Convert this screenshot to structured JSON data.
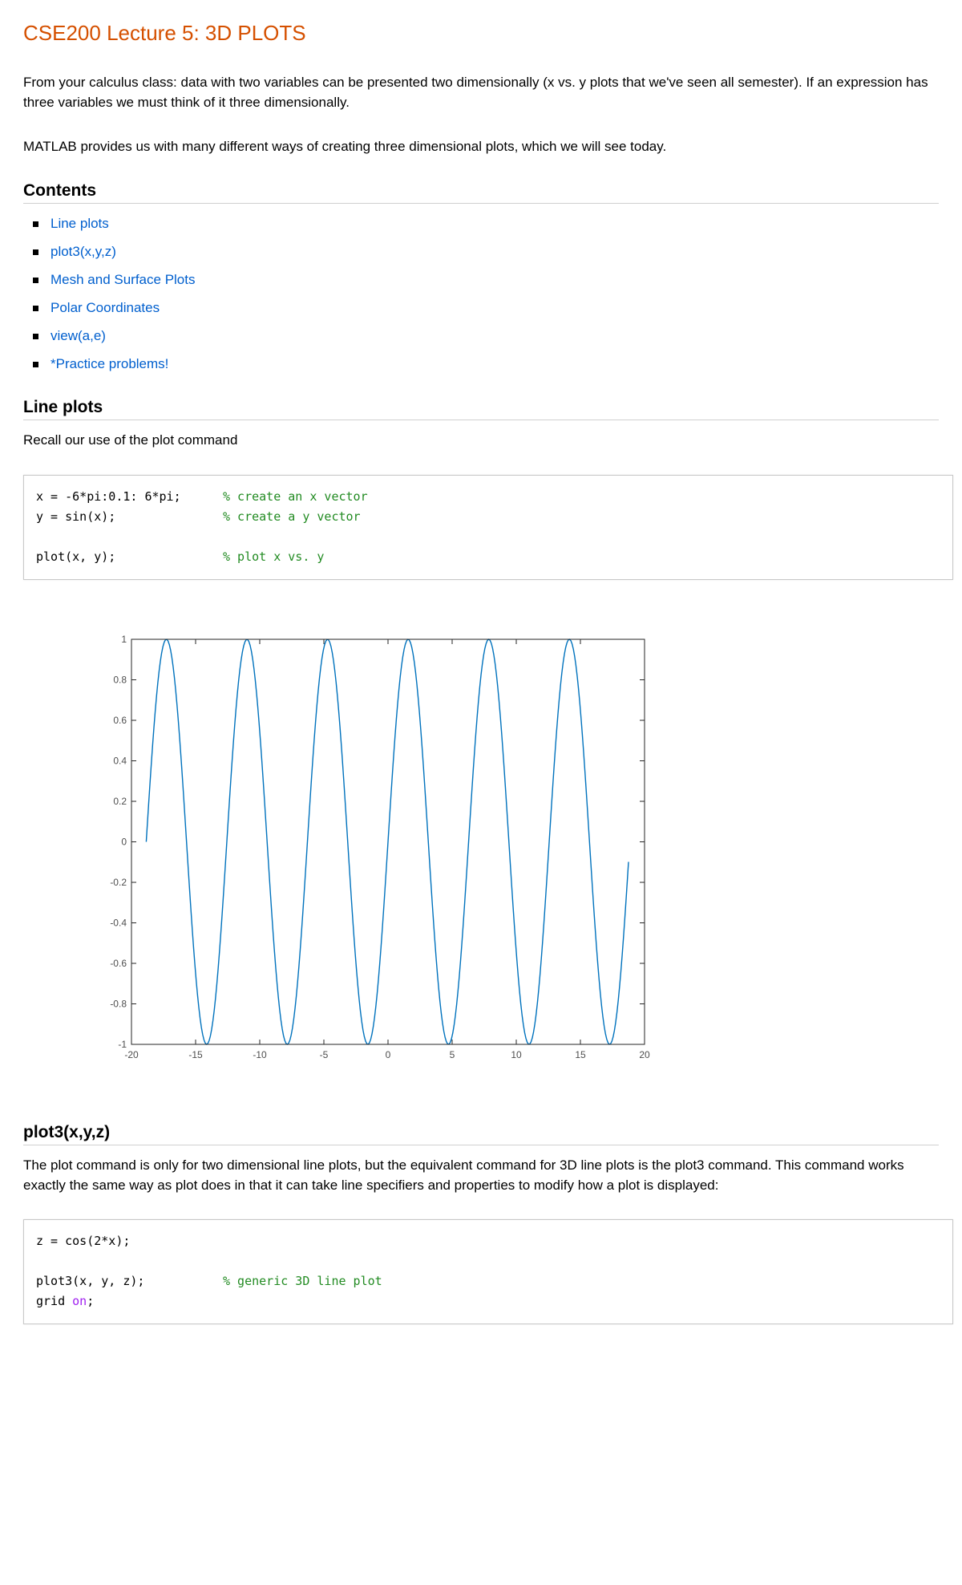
{
  "title": "CSE200 Lecture 5: 3D PLOTS",
  "intro": [
    "From your calculus class: data with two variables can be presented two dimensionally (x vs. y plots that we've seen all semester). If an expression has three variables we must think of it three dimensionally.",
    "MATLAB provides us with many different ways of creating three dimensional plots, which we will see today."
  ],
  "contents": {
    "heading": "Contents",
    "items": [
      "Line plots",
      "plot3(x,y,z)",
      "Mesh and Surface Plots",
      "Polar Coordinates",
      "view(a,e)",
      "*Practice problems!"
    ]
  },
  "line_plots": {
    "heading": "Line plots",
    "text": "Recall our use of the plot command",
    "code": [
      {
        "code": "x = -6*pi:0.1: 6*pi;",
        "comment": "% create an x vector"
      },
      {
        "code": "y = sin(x);",
        "comment": "% create a y vector"
      },
      {
        "code": "plot(x, y);",
        "comment": "% plot x vs. y"
      }
    ]
  },
  "plot3": {
    "heading": "plot3(x,y,z)",
    "text": "The plot command is only for two dimensional line plots, but the equivalent command for 3D line plots is the plot3 command. This command works exactly the same way as plot does in that it can take line specifiers and properties to modify how a plot is displayed:",
    "code": [
      {
        "code": "z = cos(2*x);",
        "comment": ""
      },
      {
        "code": "plot3(x, y, z);",
        "comment": "% generic 3D line plot"
      },
      {
        "code": "grid ",
        "keyword": "on",
        "tail": ";"
      }
    ]
  },
  "chart_data": {
    "type": "line",
    "function": "sin(x)",
    "x_start": -18.8496,
    "x_end": 18.8496,
    "x_step": 0.1,
    "xlim": [
      -20,
      20
    ],
    "ylim": [
      -1,
      1
    ],
    "xticks": [
      "-20",
      "-15",
      "-10",
      "-5",
      "0",
      "5",
      "10",
      "15",
      "20"
    ],
    "yticks": [
      "1",
      "0.8",
      "0.6",
      "0.4",
      "0.2",
      "0",
      "-0.2",
      "-0.4",
      "-0.6",
      "-0.8",
      "-1"
    ],
    "line_color": "#0072bd",
    "grid": false
  }
}
